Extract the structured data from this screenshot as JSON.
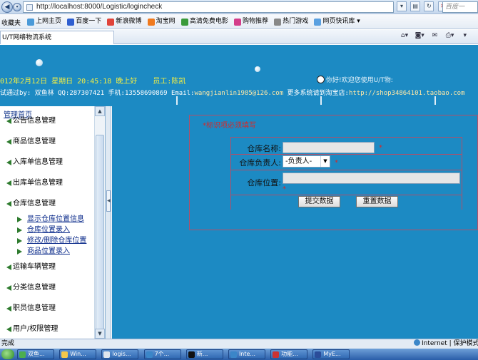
{
  "browser": {
    "url": "http://localhost:8000/Logistic/logincheck",
    "search_placeholder": "百度一",
    "favorites_label": "收藏夹",
    "favorites": [
      "上网主页",
      "百度一下",
      "新浪微博",
      "淘宝网",
      "高清免费电影",
      "购物推荐",
      "热门游戏",
      "网页快讯库 ▾"
    ],
    "tab_title": "U/T网络物流系统"
  },
  "banner": {
    "datetime": "012年2月12日 星期日 20:45:18 晚上好",
    "employee": "员工:陈凯",
    "welcome": "你好!欢迎您使用U/T物:",
    "credits": "试通过by: 双鱼林 QQ:287307421 手机:13558690869 Email:",
    "email": "wangjianlin1985@126.com",
    "shop_prefix": " 更多系统请到淘宝店:",
    "shop_url": "http://shop34864101.taobao.com"
  },
  "sidebar": {
    "home": "管理首页",
    "groups": [
      "公告信息管理",
      "商品信息管理",
      "入库单信息管理",
      "出库单信息管理",
      "仓库信息管理",
      "运输车辆管理",
      "分类信息管理",
      "职员信息管理",
      "用户/权限管理"
    ],
    "warehouse_subitems": [
      "显示仓库位置信息",
      "仓库位置录入",
      "修改/删除仓库位置",
      "商品位置录入"
    ]
  },
  "form": {
    "required_note": "*标识项必须填写",
    "name_label": "仓库名称:",
    "name_value": "",
    "manager_label": "仓库负责人:",
    "manager_selected": "-负责人-",
    "location_label": "仓库位置:",
    "location_value": "",
    "required_mark": "*",
    "submit_label": "提交数据",
    "reset_label": "重置数据"
  },
  "status": {
    "left": "完成",
    "zone": "Internet | 保护模式: 禁"
  },
  "taskbar": [
    "双鱼...",
    "Win...",
    "logis...",
    "7个...",
    "新...",
    "Inte...",
    "功能...",
    "MyE..."
  ],
  "colors": {
    "page_blue": "#1c8ac3",
    "banner_yellow": "#f3ee43",
    "required_red": "#d42a2a",
    "menu_arrow_green": "#2e7b2e"
  }
}
